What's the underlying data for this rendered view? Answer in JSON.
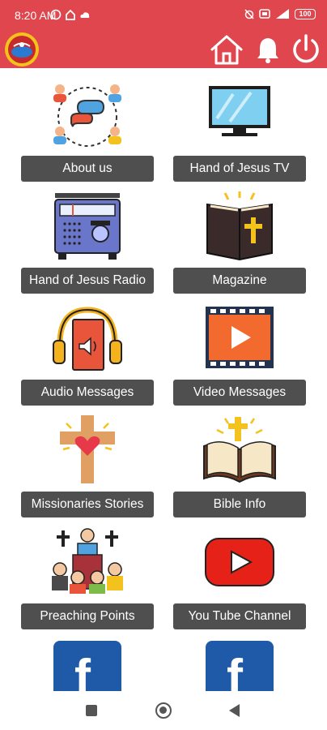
{
  "status_bar": {
    "time": "8:20 AM",
    "battery": "100",
    "left_icons": [
      "whatsapp-icon",
      "home-notification-icon",
      "cloud-icon"
    ],
    "right_icons": [
      "alarm-off-icon",
      "volte-icon",
      "signal-icon"
    ]
  },
  "app_bar": {
    "icons": [
      "app-logo",
      "home-icon",
      "bell-icon",
      "power-icon"
    ],
    "color": "#e0464d"
  },
  "tiles": [
    {
      "label": "About us",
      "icon": "people-chat-icon"
    },
    {
      "label": "Hand of Jesus TV",
      "icon": "tv-icon"
    },
    {
      "label": "Hand of Jesus Radio",
      "icon": "radio-icon"
    },
    {
      "label": "Magazine",
      "icon": "bible-book-icon"
    },
    {
      "label": "Audio Messages",
      "icon": "headphones-icon"
    },
    {
      "label": "Video Messages",
      "icon": "video-film-icon"
    },
    {
      "label": "Missionaries Stories",
      "icon": "cross-heart-icon"
    },
    {
      "label": "Bible Info",
      "icon": "open-bible-icon"
    },
    {
      "label": "Preaching Points",
      "icon": "preacher-icon"
    },
    {
      "label": "You Tube Channel",
      "icon": "youtube-icon"
    }
  ],
  "partial_tiles": [
    {
      "glyph": "f",
      "icon": "facebook-icon"
    },
    {
      "glyph": "f",
      "icon": "facebook-icon"
    }
  ],
  "nav_bar": {
    "icons": [
      "recents-icon",
      "home-circle-icon",
      "back-icon"
    ]
  }
}
